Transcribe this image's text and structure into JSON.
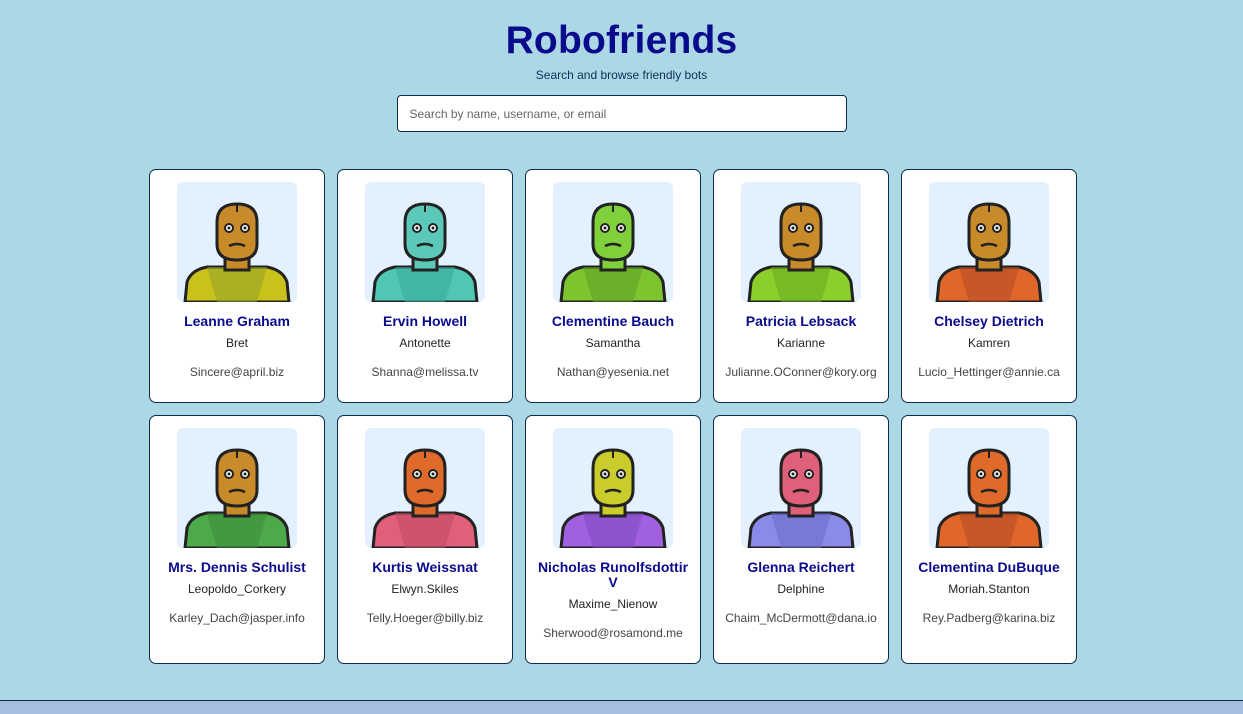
{
  "header": {
    "title": "Robofriends",
    "subtitle": "Search and browse friendly bots"
  },
  "search": {
    "placeholder": "Search by name, username, or email",
    "value": ""
  },
  "robots": [
    {
      "name": "Leanne Graham",
      "username": "Bret",
      "email": "Sincere@april.biz",
      "skin": "#c98a2a",
      "body": "#c9c21a",
      "body2": "#8fa22a"
    },
    {
      "name": "Ervin Howell",
      "username": "Antonette",
      "email": "Shanna@melissa.tv",
      "skin": "#5cc9b8",
      "body": "#4fc7b2",
      "body2": "#3aa99a"
    },
    {
      "name": "Clementine Bauch",
      "username": "Samantha",
      "email": "Nathan@yesenia.net",
      "skin": "#7fd03a",
      "body": "#7cc52f",
      "body2": "#5d9f22"
    },
    {
      "name": "Patricia Lebsack",
      "username": "Karianne",
      "email": "Julianne.OConner@kory.org",
      "skin": "#c98a2a",
      "body": "#8bcf2a",
      "body2": "#6aaa22"
    },
    {
      "name": "Chelsey Dietrich",
      "username": "Kamren",
      "email": "Lucio_Hettinger@annie.ca",
      "skin": "#c98a2a",
      "body": "#e0662a",
      "body2": "#b34a22"
    },
    {
      "name": "Mrs. Dennis Schulist",
      "username": "Leopoldo_Corkery",
      "email": "Karley_Dach@jasper.info",
      "skin": "#c98a2a",
      "body": "#4caa4a",
      "body2": "#3c8a3a"
    },
    {
      "name": "Kurtis Weissnat",
      "username": "Elwyn.Skiles",
      "email": "Telly.Hoeger@billy.biz",
      "skin": "#e06a2a",
      "body": "#e0607a",
      "body2": "#c04a62"
    },
    {
      "name": "Nicholas Runolfsdottir V",
      "username": "Maxime_Nienow",
      "email": "Sherwood@rosamond.me",
      "skin": "#c9cc2a",
      "body": "#a060e0",
      "body2": "#8048c0"
    },
    {
      "name": "Glenna Reichert",
      "username": "Delphine",
      "email": "Chaim_McDermott@dana.io",
      "skin": "#e0607a",
      "body": "#8a8ae8",
      "body2": "#6a6ac8"
    },
    {
      "name": "Clementina DuBuque",
      "username": "Moriah.Stanton",
      "email": "Rey.Padberg@karina.biz",
      "skin": "#e06a2a",
      "body": "#e0662a",
      "body2": "#b34a22"
    }
  ],
  "colors": {
    "background": "#acd8e6",
    "title": "#0a0a8c",
    "card_border": "#0b2a4e",
    "avatar_bg": "#e2f1fd"
  }
}
